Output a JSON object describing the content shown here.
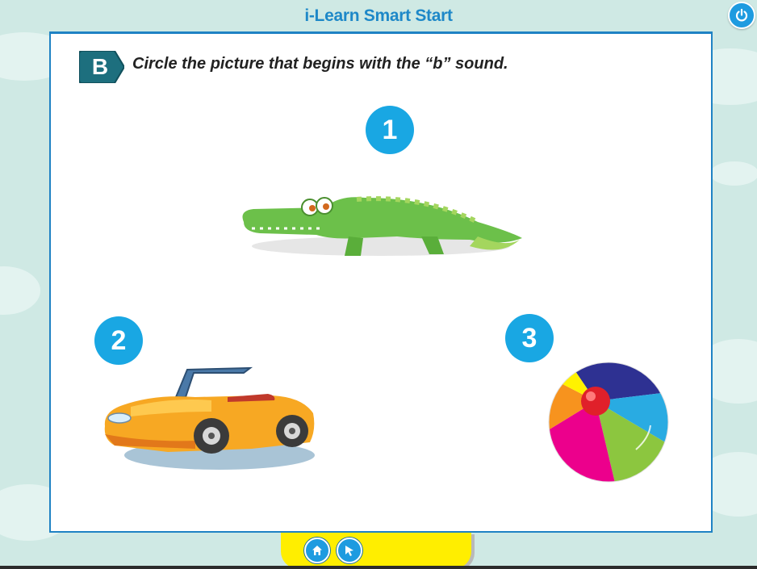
{
  "app": {
    "title": "i-Learn Smart Start"
  },
  "exercise": {
    "section_letter": "B",
    "instruction": "Circle the picture that begins with the “b” sound.",
    "options": [
      {
        "number": "1",
        "picture": "crocodile"
      },
      {
        "number": "2",
        "picture": "car"
      },
      {
        "number": "3",
        "picture": "ball"
      }
    ]
  },
  "icons": {
    "power": "power-icon",
    "home": "home-icon",
    "pointer": "cursor-arrow-icon"
  },
  "colors": {
    "background": "#cfe9e4",
    "title": "#1e88c8",
    "panel_border": "#1f82c4",
    "badge": "#19a7e3",
    "section_badge": "#1d6f7e",
    "bottom_bar": "#ffee00"
  }
}
